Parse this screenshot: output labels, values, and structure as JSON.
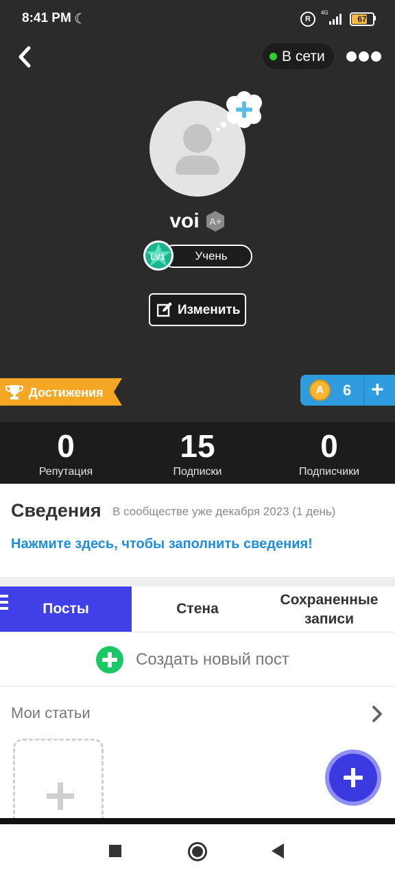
{
  "status_bar": {
    "time": "8:41 PM",
    "network": "4G",
    "battery": "67"
  },
  "header": {
    "online_label": "В сети"
  },
  "profile": {
    "username": "voi",
    "level_badge": "LV1",
    "level_title": "Учень",
    "edit_label": "Изменить"
  },
  "achievements": {
    "label": "Достижения"
  },
  "coins": {
    "count": "6",
    "coin_letter": "A"
  },
  "stats": [
    {
      "value": "0",
      "label": "Репутация"
    },
    {
      "value": "15",
      "label": "Подписки"
    },
    {
      "value": "0",
      "label": "Подписчики"
    }
  ],
  "info": {
    "heading": "Сведения",
    "member_since": "В сообществе уже декабря 2023 (1 день)",
    "fill_link": "Нажмите здесь, чтобы заполнить сведения!"
  },
  "tabs": [
    {
      "label": "Посты",
      "active": true
    },
    {
      "label": "Стена",
      "active": false
    },
    {
      "label": "Сохраненные записи",
      "active": false
    }
  ],
  "new_post": {
    "label": "Создать новый пост"
  },
  "articles": {
    "heading": "Мои статьи"
  },
  "colors": {
    "accent_blue": "#4040e8",
    "link_blue": "#1c8ee0",
    "online_green": "#2dd12d",
    "achievement_orange": "#f5a623",
    "coin_blue": "#2f9ce0"
  }
}
